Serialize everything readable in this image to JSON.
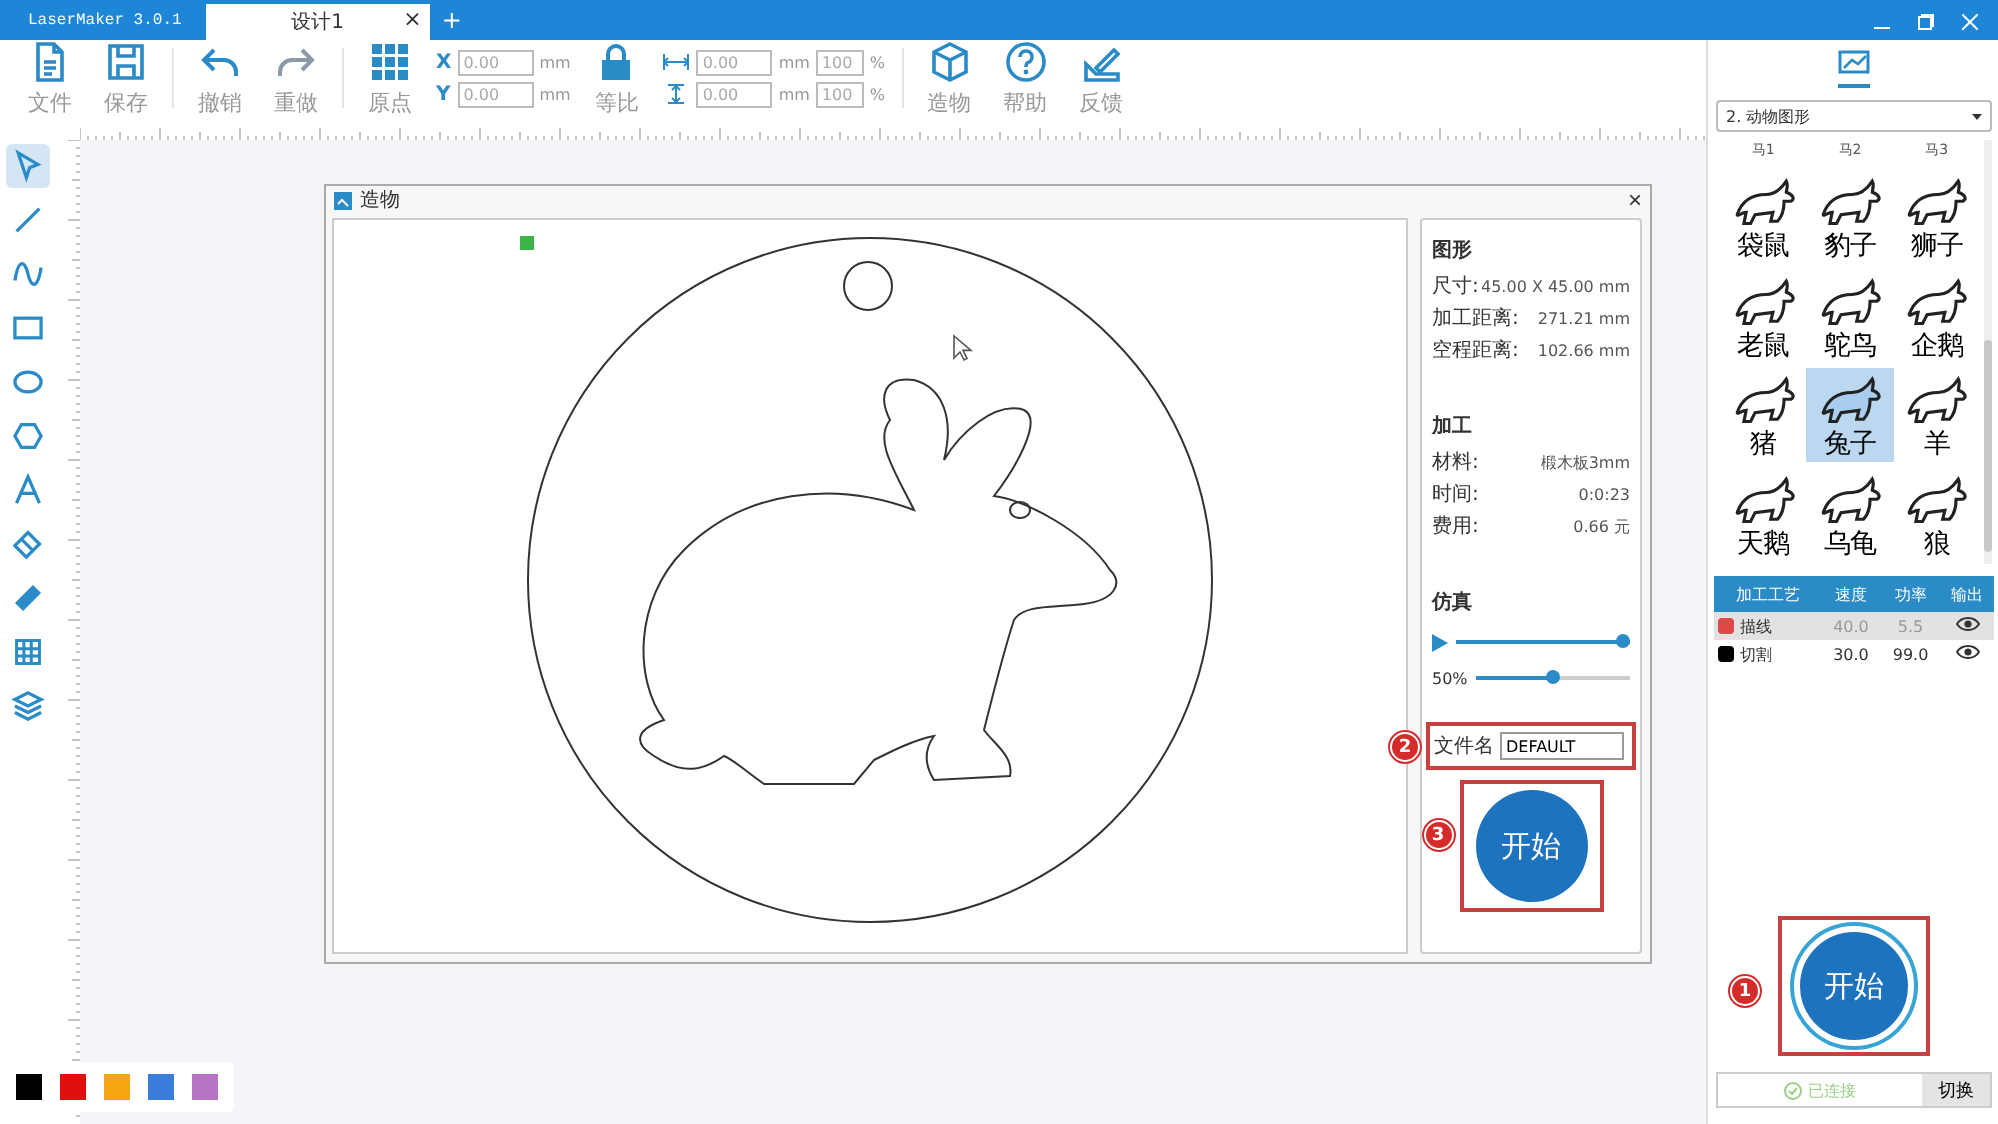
{
  "app": {
    "title": "LaserMaker 3.0.1"
  },
  "tabs": [
    {
      "label": "设计1",
      "selected": true,
      "close": "×"
    }
  ],
  "new_tab": "+",
  "toolbar": {
    "file_buttons": [
      {
        "label": "文件"
      },
      {
        "label": "保存"
      }
    ],
    "edit_buttons": [
      {
        "label": "撤销"
      },
      {
        "label": "重做"
      }
    ],
    "origin": {
      "label": "原点"
    },
    "position": {
      "x_label": "X",
      "x_value": "0.00",
      "x_unit": "mm",
      "y_label": "Y",
      "y_value": "0.00",
      "y_unit": "mm"
    },
    "lock": {
      "label": "等比"
    },
    "size": {
      "width_value": "0.00",
      "width_unit": "mm",
      "width_scale": "100",
      "width_percent": "%",
      "height_value": "0.00",
      "height_unit": "mm",
      "height_scale": "100",
      "height_percent": "%"
    },
    "action_buttons": [
      {
        "label": "造物"
      },
      {
        "label": "帮助"
      },
      {
        "label": "反馈"
      }
    ]
  },
  "tools": [
    {
      "kind": "select",
      "selected": true
    },
    {
      "kind": "line",
      "selected": false
    },
    {
      "kind": "curve",
      "selected": false
    },
    {
      "kind": "rect",
      "selected": false
    },
    {
      "kind": "ellipse",
      "selected": false
    },
    {
      "kind": "polygon",
      "selected": false
    },
    {
      "kind": "text",
      "selected": false
    },
    {
      "kind": "eraser",
      "selected": false
    },
    {
      "kind": "ruler",
      "selected": false
    },
    {
      "kind": "table",
      "selected": false
    },
    {
      "kind": "layers",
      "selected": false
    }
  ],
  "palette": [
    {
      "color": "#000000"
    },
    {
      "color": "#e01010"
    },
    {
      "color": "#f5a511"
    },
    {
      "color": "#3b7ddd"
    },
    {
      "color": "#b873c4"
    }
  ],
  "dialog": {
    "title": "造物",
    "close": "×",
    "shape_section": {
      "heading": "图形",
      "rows": [
        {
          "label": "尺寸:",
          "value": "45.00 X 45.00 mm"
        },
        {
          "label": "加工距离:",
          "value": "271.21 mm"
        },
        {
          "label": "空程距离:",
          "value": "102.66 mm"
        }
      ]
    },
    "process_section": {
      "heading": "加工",
      "rows": [
        {
          "label": "材料:",
          "value": "椴木板3mm"
        },
        {
          "label": "时间:",
          "value": "0:0:23"
        },
        {
          "label": "费用:",
          "value": "0.66 元"
        }
      ]
    },
    "simulation": {
      "heading": "仿真",
      "progress": {
        "level": 1.0
      },
      "speed": {
        "label": "50%",
        "level": 0.5
      }
    },
    "filename": {
      "label": "文件名",
      "value": "DEFAULT",
      "badge": "2"
    },
    "start": {
      "label": "开始",
      "badge": "3"
    }
  },
  "library": {
    "category": "2. 动物图形",
    "top_labels": [
      "马1",
      "马2",
      "马3"
    ],
    "shapes": [
      {
        "label": "袋鼠",
        "selected": false
      },
      {
        "label": "豹子",
        "selected": false
      },
      {
        "label": "狮子",
        "selected": false
      },
      {
        "label": "老鼠",
        "selected": false
      },
      {
        "label": "鸵鸟",
        "selected": false
      },
      {
        "label": "企鹅",
        "selected": false
      },
      {
        "label": "猪",
        "selected": false
      },
      {
        "label": "兔子",
        "selected": true
      },
      {
        "label": "羊",
        "selected": false
      },
      {
        "label": "天鹅",
        "selected": false
      },
      {
        "label": "乌龟",
        "selected": false
      },
      {
        "label": "狼",
        "selected": false
      }
    ]
  },
  "layers": {
    "columns": [
      "加工工艺",
      "速度",
      "功率",
      "输出"
    ],
    "rows": [
      {
        "color": "#e04848",
        "name": "描线",
        "speed": "40.0",
        "power": "5.5",
        "visible": true,
        "selected": true
      },
      {
        "color": "#000000",
        "name": "切割",
        "speed": "30.0",
        "power": "99.0",
        "visible": true,
        "selected": false
      }
    ]
  },
  "start": {
    "label": "开始",
    "badge": "1"
  },
  "status": {
    "text": "已连接",
    "button": "切换"
  }
}
